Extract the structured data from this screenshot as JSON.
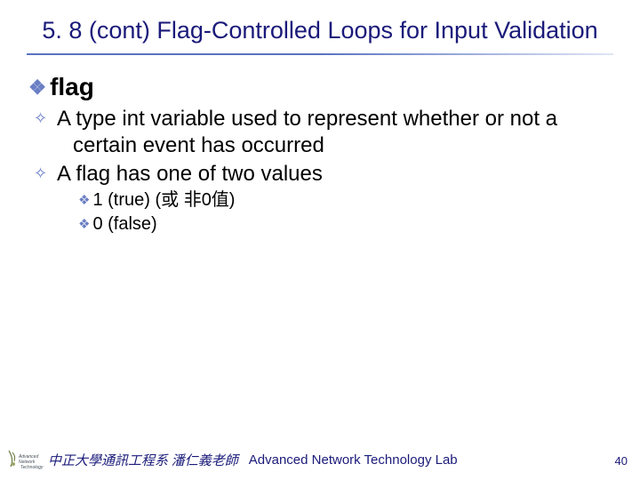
{
  "title": "5. 8 (cont) Flag-Controlled Loops for Input Validation",
  "content": {
    "heading": "flag",
    "def1": "A type int variable used to represent whether or not a certain event has occurred",
    "def2": "A flag has one of two values",
    "val1": "1 (true)  (或 非0值)",
    "val2": "0 (false)"
  },
  "footer": {
    "cn": "中正大學通訊工程系 潘仁義老師",
    "en": "Advanced Network Technology Lab"
  },
  "page": "40"
}
